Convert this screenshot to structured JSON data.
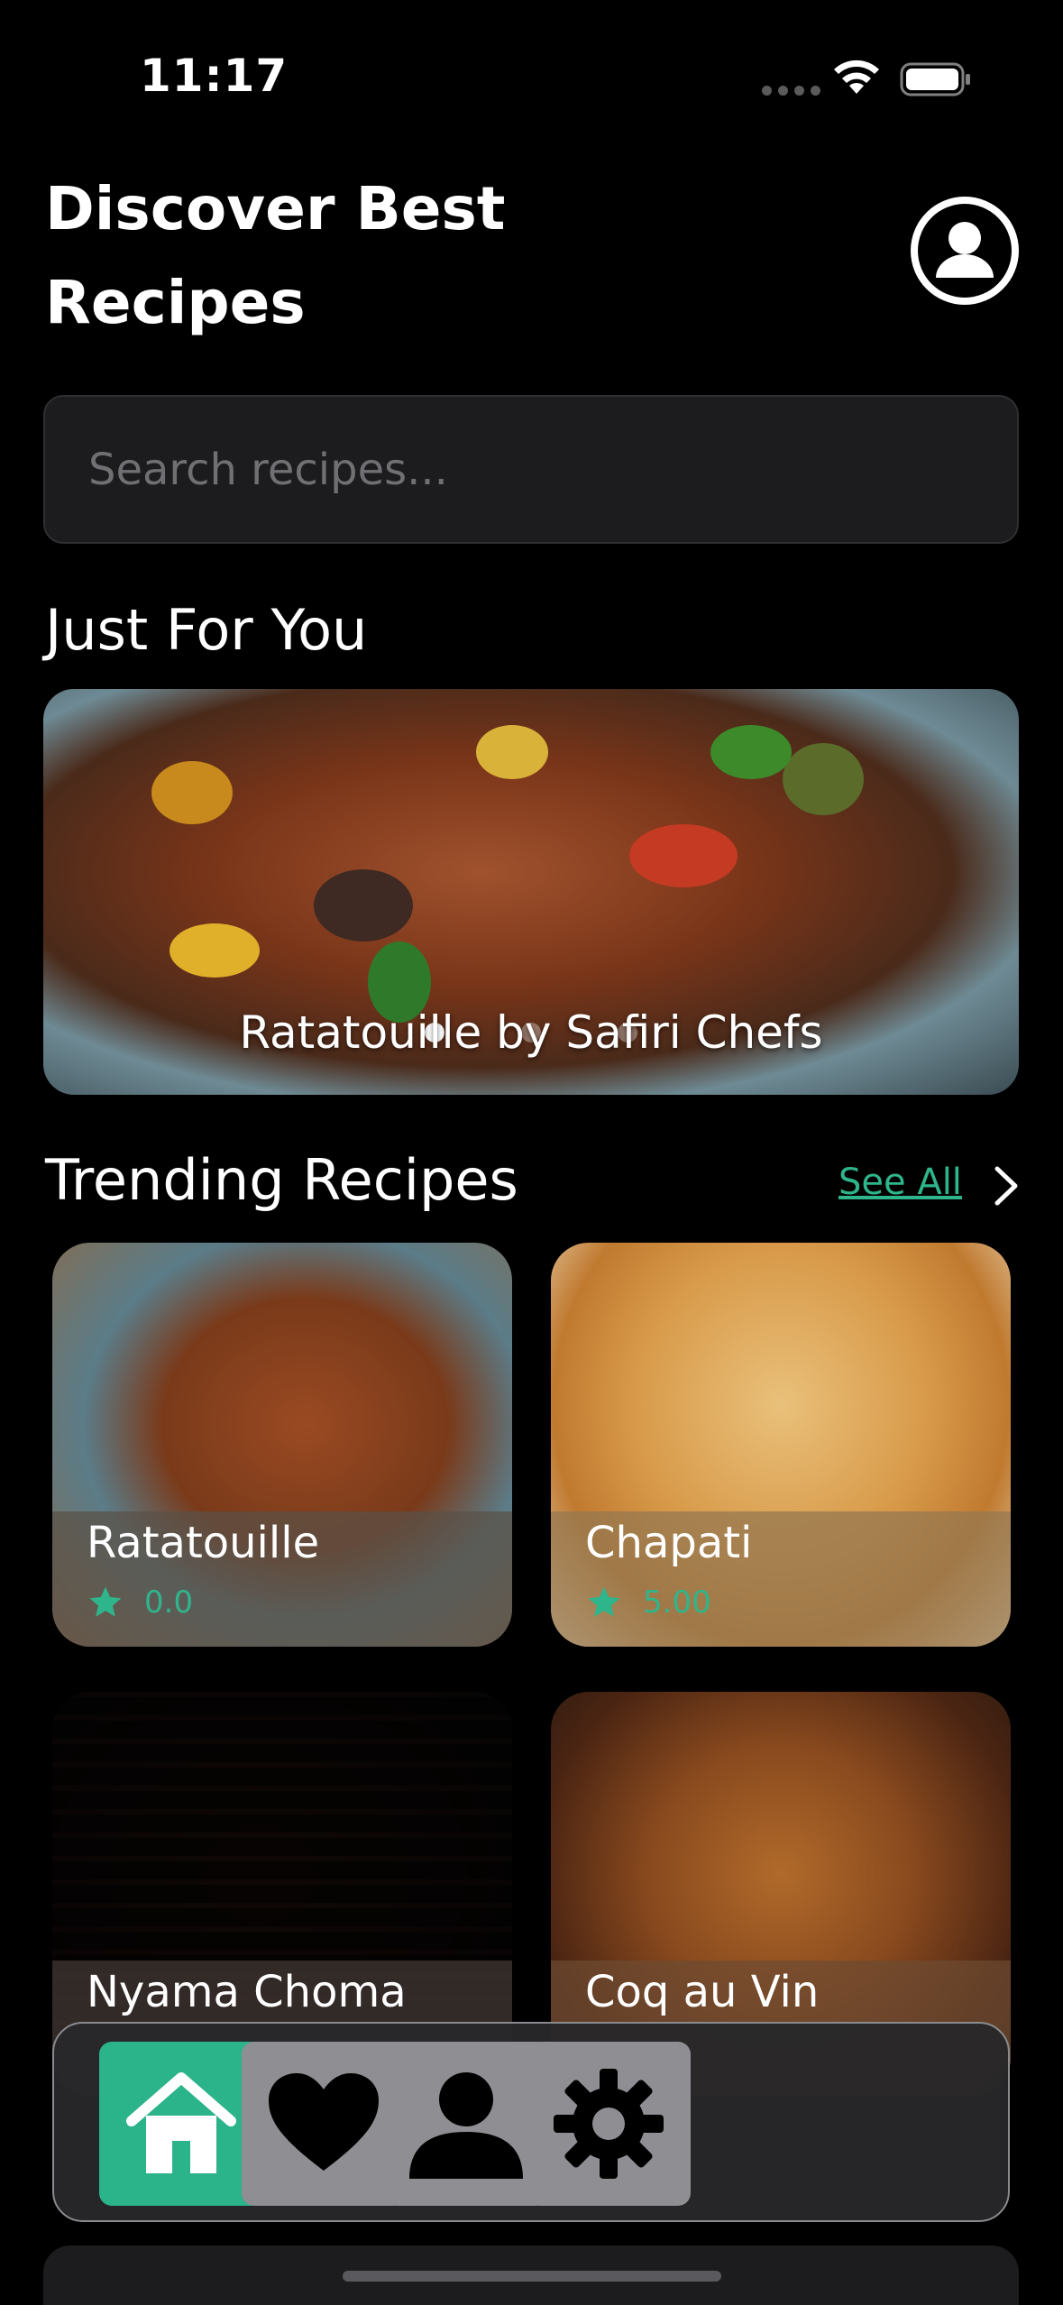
{
  "status_bar": {
    "time": "11:17"
  },
  "header": {
    "title": "Discover Best Recipes"
  },
  "search": {
    "placeholder": "Search recipes..."
  },
  "just_for_you": {
    "heading": "Just For You",
    "caption": "Ratatouille by Safiri Chefs"
  },
  "trending": {
    "heading": "Trending Recipes",
    "see_all": "See All",
    "cards": [
      {
        "name": "Ratatouille",
        "rating": "0.0"
      },
      {
        "name": "Chapati",
        "rating": "5.00"
      },
      {
        "name": "Nyama Choma"
      },
      {
        "name": "Coq au Vin"
      }
    ]
  },
  "bottom_nav": {
    "items": [
      "home-icon",
      "heart-icon",
      "user-icon",
      "gear-icon"
    ],
    "active": "home-icon"
  },
  "colors": {
    "accent": "#2bb38a",
    "background": "#000000"
  }
}
